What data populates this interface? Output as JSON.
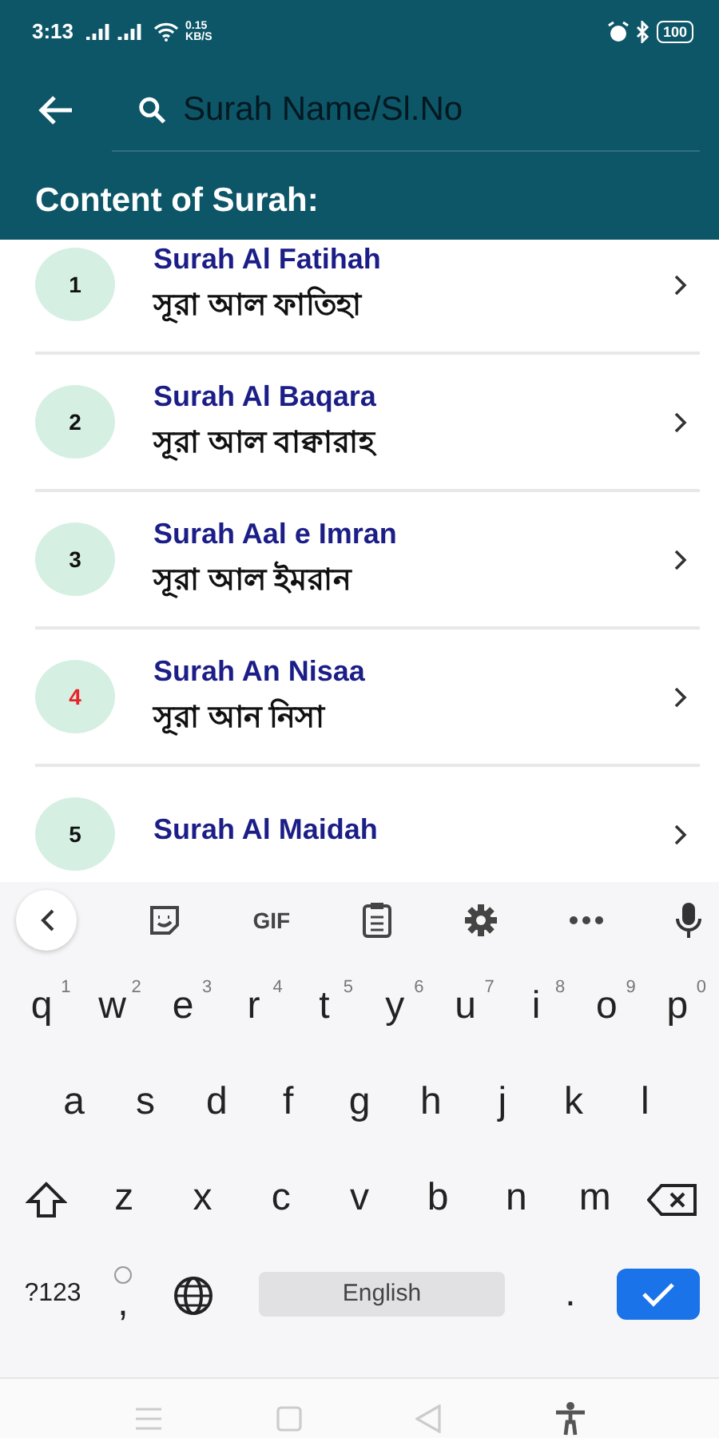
{
  "status_bar": {
    "time": "3:13",
    "speed": "0.15",
    "speed_unit": "KB/S",
    "battery": "100"
  },
  "search": {
    "placeholder": "Surah Name/Sl.No"
  },
  "title": "Content of Surah:",
  "surahs": [
    {
      "number": "1",
      "color": "#111111",
      "name": "Surah Al Fatihah",
      "bengali": "সূরা আল ফাতিহা"
    },
    {
      "number": "2",
      "color": "#111111",
      "name": "Surah Al Baqara",
      "bengali": "সূরা আল বাক্বারাহ"
    },
    {
      "number": "3",
      "color": "#111111",
      "name": "Surah Aal e Imran",
      "bengali": "সূরা আল ইমরান"
    },
    {
      "number": "4",
      "color": "#e8242b",
      "name": "Surah An Nisaa",
      "bengali": "সূরা আন নিসা"
    },
    {
      "number": "5",
      "color": "#111111",
      "name": "Surah Al Maidah"
    }
  ],
  "keyboard": {
    "toolbar": [
      "GIF"
    ],
    "rows": [
      {
        "keys": [
          {
            "kind": "letter",
            "label": "q",
            "hint": "1"
          },
          {
            "kind": "letter",
            "label": "w",
            "hint": "2"
          },
          {
            "kind": "letter",
            "label": "e",
            "hint": "3"
          },
          {
            "kind": "letter",
            "label": "r",
            "hint": "4"
          },
          {
            "kind": "letter",
            "label": "t",
            "hint": "5"
          },
          {
            "kind": "letter",
            "label": "y",
            "hint": "6"
          },
          {
            "kind": "letter",
            "label": "u",
            "hint": "7"
          },
          {
            "kind": "letter",
            "label": "i",
            "hint": "8"
          },
          {
            "kind": "letter",
            "label": "o",
            "hint": "9"
          },
          {
            "kind": "letter",
            "label": "p",
            "hint": "0"
          }
        ]
      },
      {
        "keys": [
          {
            "kind": "letter",
            "label": "a"
          },
          {
            "kind": "letter",
            "label": "s"
          },
          {
            "kind": "letter",
            "label": "d"
          },
          {
            "kind": "letter",
            "label": "f"
          },
          {
            "kind": "letter",
            "label": "g"
          },
          {
            "kind": "letter",
            "label": "h"
          },
          {
            "kind": "letter",
            "label": "j"
          },
          {
            "kind": "letter",
            "label": "k"
          },
          {
            "kind": "letter",
            "label": "l"
          }
        ]
      },
      {
        "keys": [
          {
            "kind": "shift"
          },
          {
            "kind": "letter",
            "label": "z"
          },
          {
            "kind": "letter",
            "label": "x"
          },
          {
            "kind": "letter",
            "label": "c"
          },
          {
            "kind": "letter",
            "label": "v"
          },
          {
            "kind": "letter",
            "label": "b"
          },
          {
            "kind": "letter",
            "label": "n"
          },
          {
            "kind": "letter",
            "label": "m"
          },
          {
            "kind": "backspace"
          }
        ]
      },
      {
        "keys": [
          {
            "kind": "symbols",
            "label": "?123"
          },
          {
            "kind": "comma",
            "label": ","
          },
          {
            "kind": "globe"
          },
          {
            "kind": "space",
            "label": "English"
          },
          {
            "kind": "period",
            "label": "."
          },
          {
            "kind": "enter"
          }
        ]
      }
    ]
  }
}
